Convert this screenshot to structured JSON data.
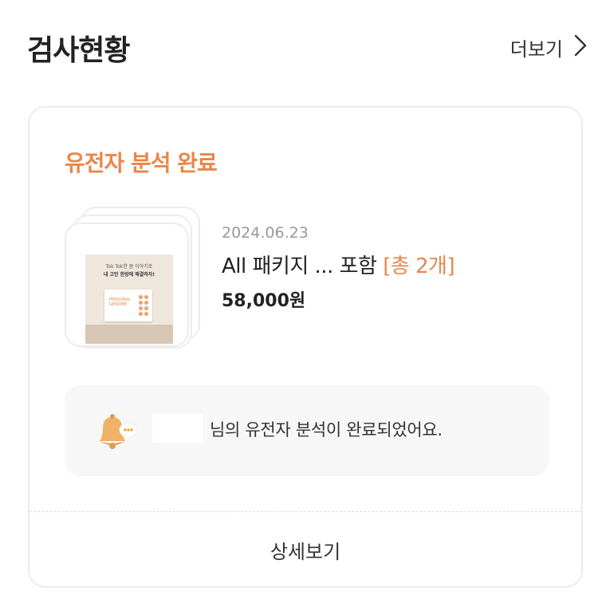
{
  "header": {
    "title": "검사현황",
    "more_label": "더보기"
  },
  "card": {
    "status_title": "유전자 분석 완료",
    "product": {
      "date": "2024.06.23",
      "name": "All 패키지 ... 포함",
      "count_label": "[총 2개]",
      "price": "58,000원",
      "image_text_line1": "Tok Tok한 몸 이야기로",
      "image_text_line2": "내 고민 한방에 해결하자!",
      "image_box_text": "PERSONAL GENOME"
    },
    "notice": {
      "message": "님의 유전자 분석이 완료되었어요."
    },
    "detail_button_label": "상세보기"
  },
  "colors": {
    "accent": "#e8874a",
    "card_border": "#ececec",
    "notice_bg": "#f7f7f7"
  },
  "icons": {
    "more": "chevron-right-icon",
    "notice": "bell-icon"
  }
}
